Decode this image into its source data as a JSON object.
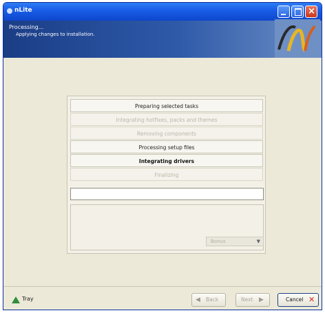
{
  "window": {
    "title": "nLite"
  },
  "header": {
    "title": "Processing...",
    "subtitle": "Applying changes to installation."
  },
  "steps": [
    {
      "label": "Preparing selected tasks",
      "state": "done"
    },
    {
      "label": "Integrating hotfixes, packs and themes",
      "state": "skipped"
    },
    {
      "label": "Removing components",
      "state": "skipped"
    },
    {
      "label": "Processing setup files",
      "state": "done"
    },
    {
      "label": "Integrating drivers",
      "state": "current"
    },
    {
      "label": "Finalizing",
      "state": "pending"
    }
  ],
  "progress": {
    "value": 0
  },
  "log": {
    "select_value": "Bonus"
  },
  "footer": {
    "tray_label": "Tray",
    "back_label": "Back",
    "next_label": "Next",
    "cancel_label": "Cancel"
  },
  "icons": {
    "back": "back-arrow-icon",
    "next": "next-arrow-icon",
    "cancel": "cancel-x-icon",
    "tray": "tray-icon"
  },
  "colors": {
    "titlebar": "#1a5ee8",
    "header": "#1b3d86",
    "window_bg": "#ece9d8",
    "cancel_x": "#d42a1f"
  }
}
